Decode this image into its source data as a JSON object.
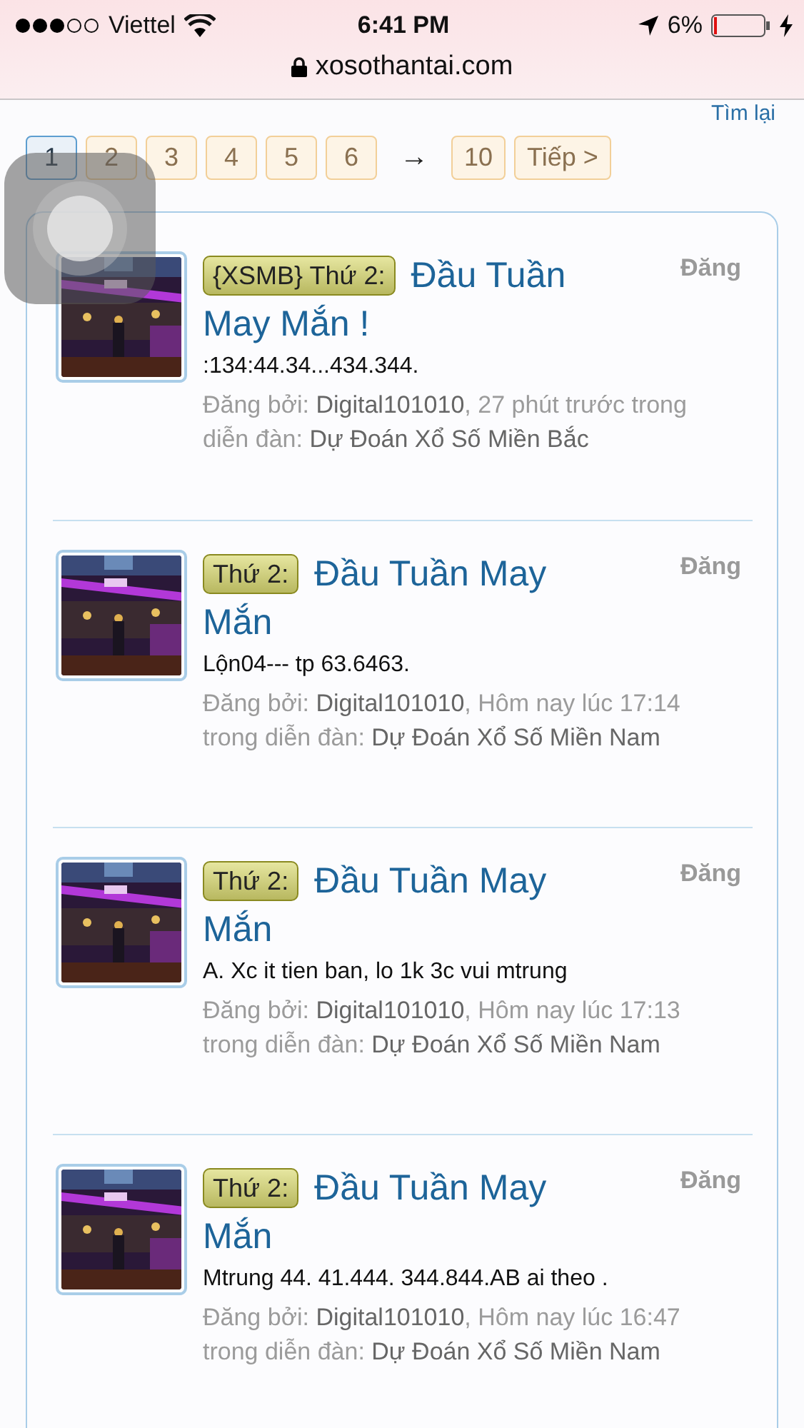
{
  "status_bar": {
    "carrier": "Viettel",
    "time": "6:41 PM",
    "battery": "6%",
    "url": "xosothantai.com"
  },
  "search_again_link": "Tìm lại",
  "pagination": {
    "pages": [
      {
        "label": "1",
        "selected": true
      },
      {
        "label": "2",
        "selected": false
      },
      {
        "label": "3",
        "selected": false
      },
      {
        "label": "4",
        "selected": false
      },
      {
        "label": "5",
        "selected": false
      },
      {
        "label": "6",
        "selected": false
      }
    ],
    "gap": "→",
    "last": "10",
    "next": "Tiếp >"
  },
  "threads": [
    {
      "prefix": "{XSMB} Thứ 2:",
      "title": "Đầu Tuần May Mắn !",
      "action": "Đăng",
      "snippet": ":134:44.34...434.344.",
      "by_label": "Đăng bởi:",
      "author": "Digital101010",
      "time": ", 27 phút trước",
      "forum_label": "trong diễn đàn:",
      "forum": "Dự Đoán Xổ Số Miền Bắc"
    },
    {
      "prefix": "Thứ 2:",
      "title": "Đầu Tuần May Mắn",
      "action": "Đăng",
      "snippet": "Lộn04--- tp 63.6463.",
      "by_label": "Đăng bởi:",
      "author": "Digital101010",
      "time": ", Hôm nay lúc 17:14",
      "forum_label": "trong diễn đàn:",
      "forum": "Dự Đoán Xổ Số Miền Nam"
    },
    {
      "prefix": "Thứ 2:",
      "title": "Đầu Tuần May Mắn",
      "action": "Đăng",
      "snippet": "A. Xc it tien ban, lo 1k 3c vui mtrung",
      "by_label": "Đăng bởi:",
      "author": "Digital101010",
      "time": ", Hôm nay lúc 17:13",
      "forum_label": "trong diễn đàn:",
      "forum": "Dự Đoán Xổ Số Miền Nam"
    },
    {
      "prefix": "Thứ 2:",
      "title": "Đầu Tuần May Mắn",
      "action": "Đăng",
      "snippet": "Mtrung 44. 41.444. 344.844.AB ai theo .",
      "by_label": "Đăng bởi:",
      "author": "Digital101010",
      "time": ", Hôm nay lúc 16:47",
      "forum_label": "trong diễn đàn:",
      "forum": "Dự Đoán Xổ Số Miền Nam"
    }
  ]
}
